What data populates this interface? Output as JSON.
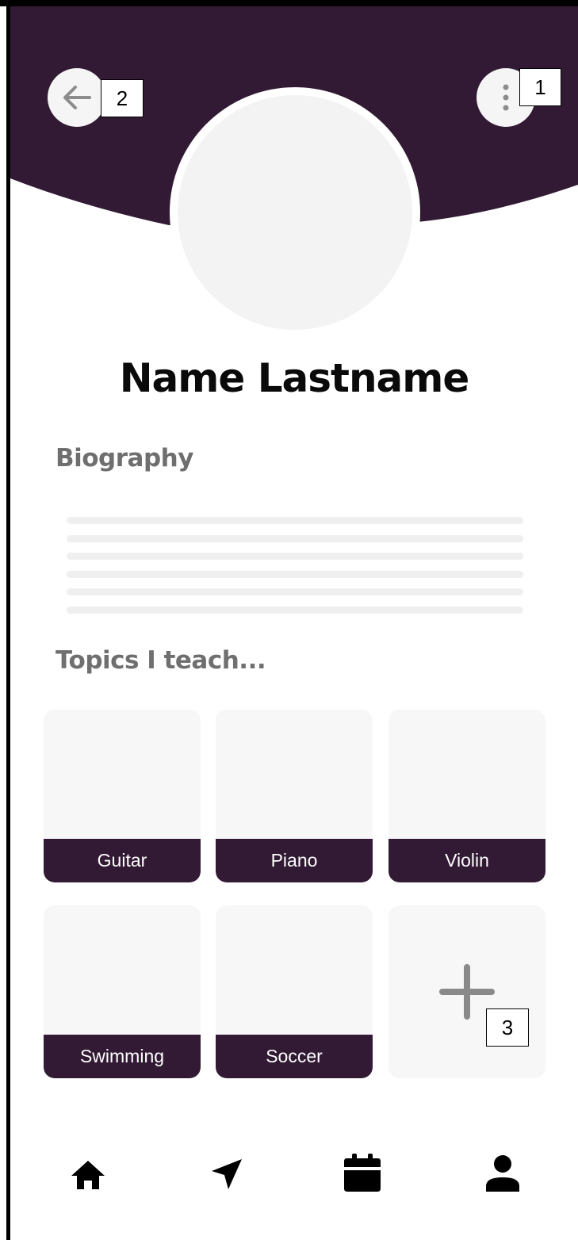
{
  "colors": {
    "header": "#321a34",
    "tile_label_bg": "#321a34",
    "tile_bg": "#f7f7f7",
    "section_title": "#6f6f6f"
  },
  "header": {
    "back_icon": "arrow-left-icon",
    "more_icon": "more-vertical-icon"
  },
  "annotations": [
    "1",
    "2",
    "3"
  ],
  "profile": {
    "name": "Name Lastname"
  },
  "biography": {
    "title": "Biography",
    "line_count": 6
  },
  "topics": {
    "title": "Topics I teach...",
    "items": [
      "Guitar",
      "Piano",
      "Violin",
      "Swimming",
      "Soccer"
    ],
    "add_icon": "plus-icon"
  },
  "bottom_nav": {
    "items": [
      "home-icon",
      "send-icon",
      "calendar-icon",
      "profile-icon"
    ]
  }
}
